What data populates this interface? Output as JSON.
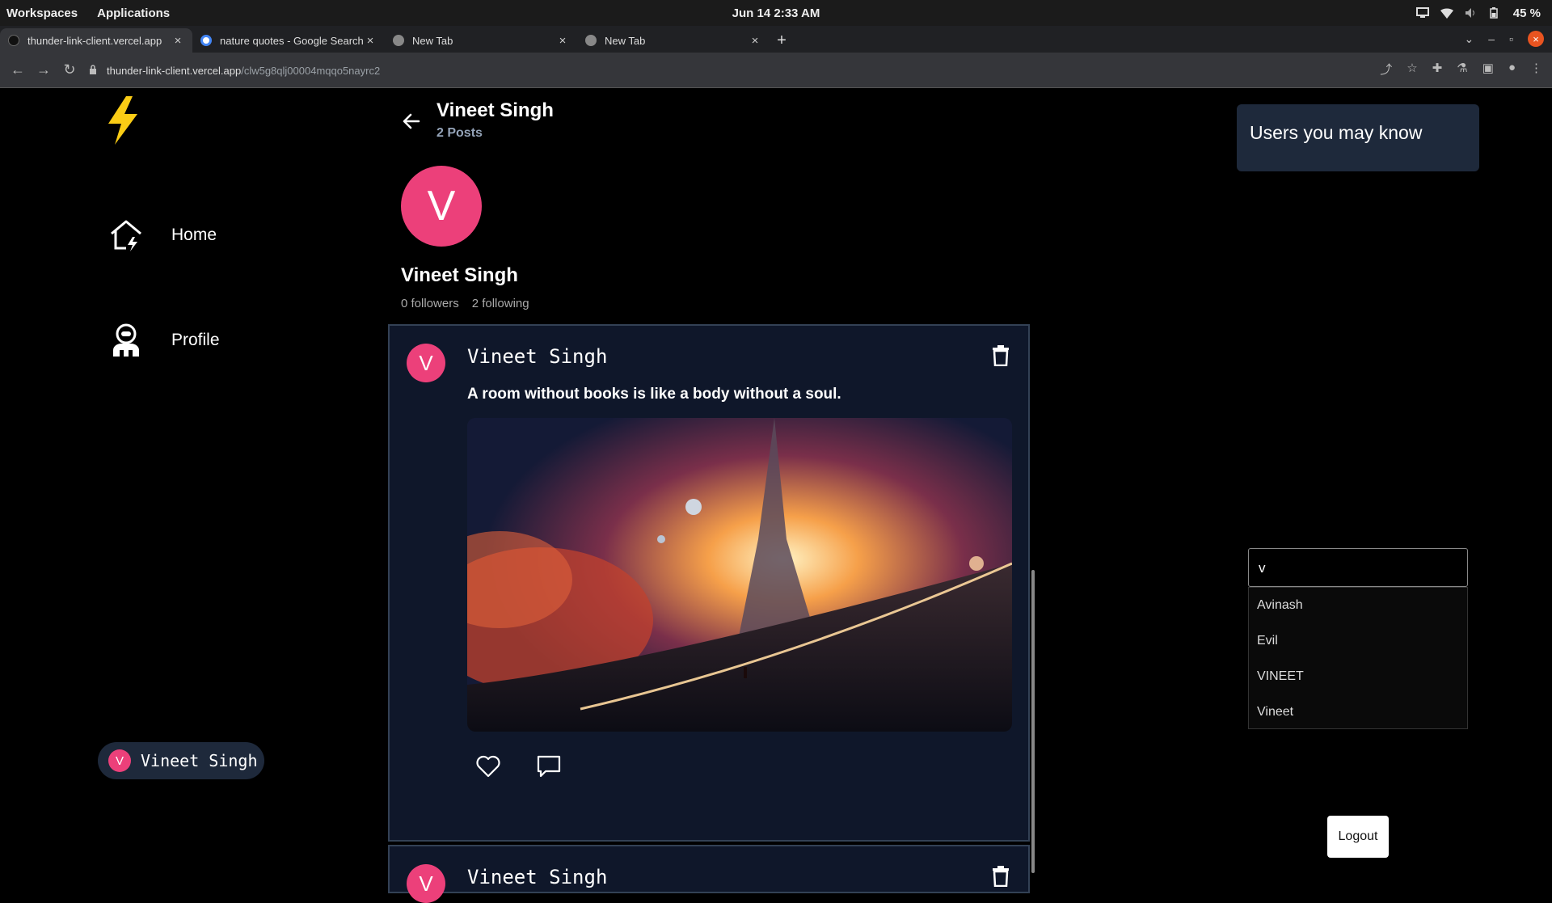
{
  "system_bar": {
    "workspaces": "Workspaces",
    "applications": "Applications",
    "datetime": "Jun 14  2:33 AM",
    "battery": "45 %"
  },
  "browser": {
    "tabs": [
      {
        "title": "thunder-link-client.vercel.app",
        "active": true
      },
      {
        "title": "nature quotes - Google Search",
        "active": false
      },
      {
        "title": "New Tab",
        "active": false
      },
      {
        "title": "New Tab",
        "active": false
      }
    ],
    "url_host": "thunder-link-client.vercel.app",
    "url_path": "/clw5g8qlj00004mqqo5nayrc2"
  },
  "sidebar": {
    "items": [
      {
        "label": "Home",
        "icon": "home-icon"
      },
      {
        "label": "Profile",
        "icon": "profile-icon"
      }
    ],
    "current_user": {
      "initial": "V",
      "name": "Vineet Singh"
    }
  },
  "profile": {
    "header_name": "Vineet Singh",
    "posts_count": "2 Posts",
    "avatar_initial": "V",
    "name": "Vineet Singh",
    "followers": "0 followers",
    "following": "2 following"
  },
  "posts": [
    {
      "author_initial": "V",
      "author": "Vineet Singh",
      "text": "A room without books is like a body without a soul."
    },
    {
      "author_initial": "V",
      "author": "Vineet Singh",
      "text": ""
    }
  ],
  "right_panel": {
    "suggest_title": "Users you may know",
    "search_value": "v",
    "results": [
      "Avinash",
      "Evil",
      "VINEET",
      "Vineet"
    ],
    "logout": "Logout"
  },
  "colors": {
    "accent_pink": "#ec407a",
    "card_bg": "#0f172a",
    "panel_bg": "#1e293b",
    "logo_yellow": "#facc15"
  }
}
